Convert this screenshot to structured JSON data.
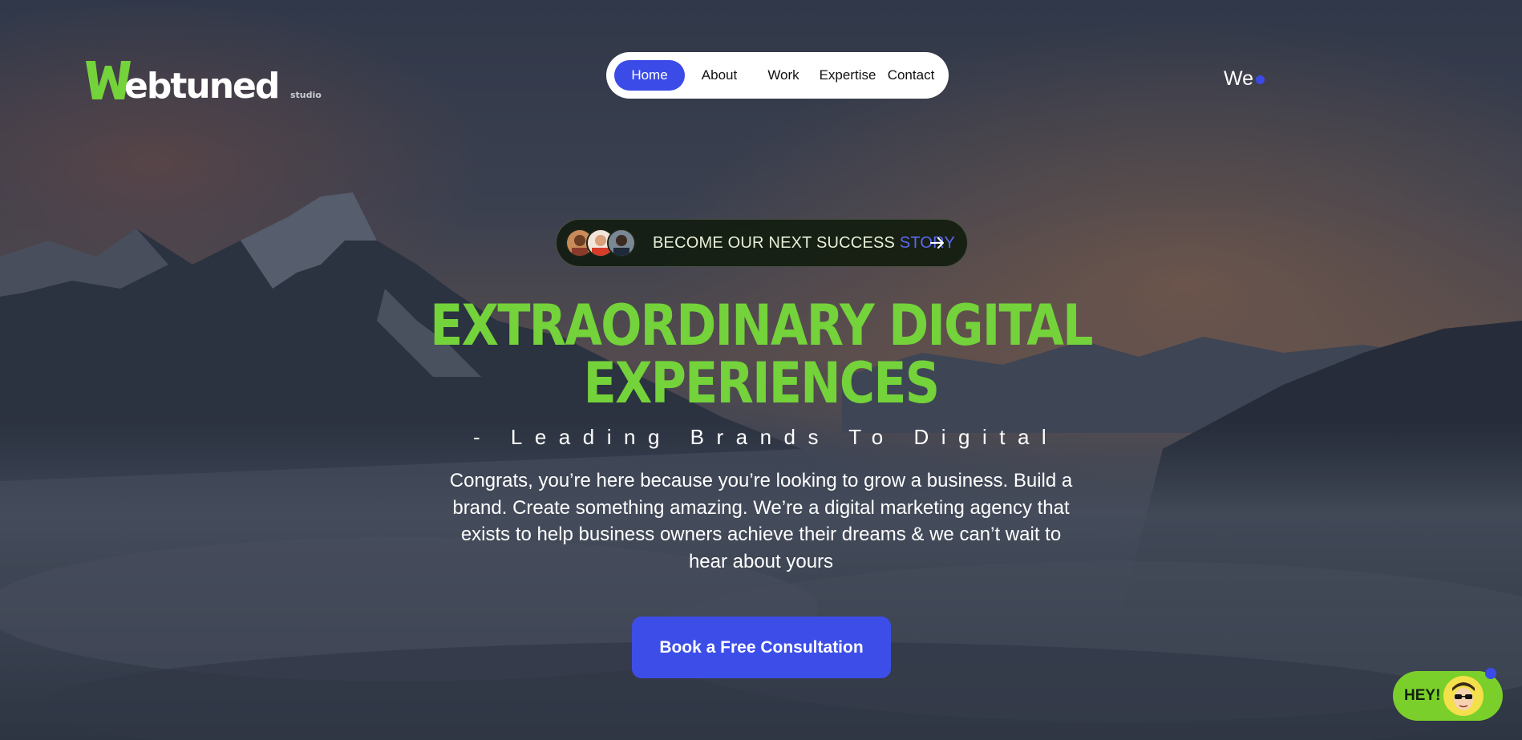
{
  "logo": {
    "mark": "W",
    "wordmark": "ebtuned",
    "sub": "studio",
    "brand_color": "#74d23a"
  },
  "nav": {
    "items": [
      {
        "label": "Home",
        "active": true
      },
      {
        "label": "About",
        "active": false
      },
      {
        "label": "Work",
        "active": false
      },
      {
        "label": "Expertise",
        "active": false
      },
      {
        "label": "Contact",
        "active": false
      }
    ],
    "active_color": "#3b4be8"
  },
  "header_right": {
    "label": "We"
  },
  "story_badge": {
    "text": "BECOME OUR NEXT SUCCESS",
    "accent": "STORY",
    "arrow_icon": "arrow-right-icon"
  },
  "hero": {
    "headline_line1": "EXTRAORDINARY DIGITAL",
    "headline_line2": "EXPERIENCES",
    "headline_color": "#74d23a",
    "tagline": "- Leading Brands To Digital",
    "intro": "Congrats, you’re here because you’re looking to grow a business. Build a brand. Create something amazing. We’re a digital marketing agency that exists to help business owners achieve their dreams & we can’t wait to hear about yours"
  },
  "cta": {
    "label": "Book a Free Consultation",
    "color": "#3d4ee8"
  },
  "chat_widget": {
    "label": "HEY!",
    "color": "#7bcf2a",
    "icon": "mascot-face-icon"
  }
}
